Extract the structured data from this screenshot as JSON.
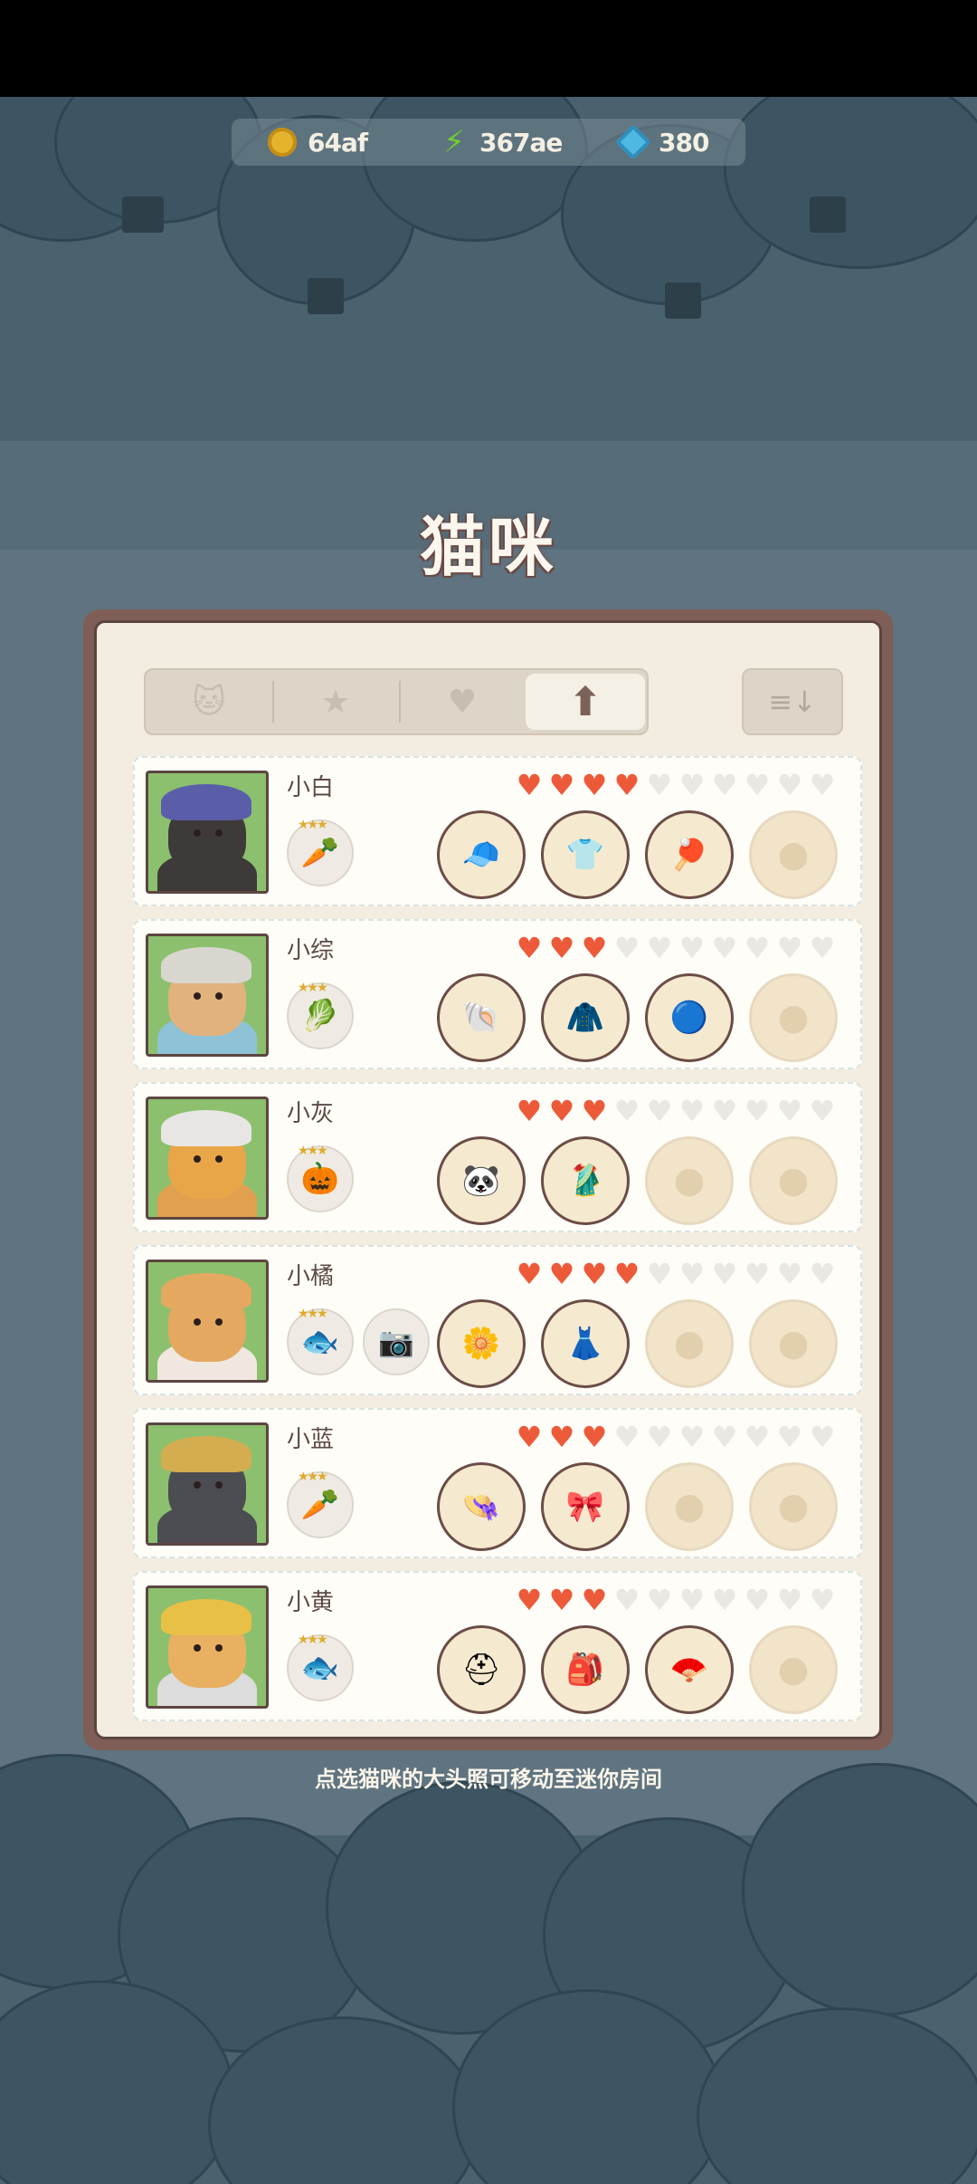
{
  "resources": [
    {
      "icon": "coin-icon",
      "value": "64af"
    },
    {
      "icon": "energy-bolt-icon",
      "value": "367ae"
    },
    {
      "icon": "gem-icon",
      "value": "380"
    }
  ],
  "title": "猫咪",
  "tabs": [
    {
      "icon": "cat-icon",
      "glyph": "🐱"
    },
    {
      "icon": "star-icon",
      "glyph": "★"
    },
    {
      "icon": "heart-icon",
      "glyph": "♥"
    },
    {
      "icon": "up-arrow-icon",
      "glyph": "⬆"
    }
  ],
  "sort_glyph": "≡↓",
  "cats": [
    {
      "name": "小白",
      "hearts": 4,
      "food": "🥕",
      "extra": "",
      "slots": [
        "🧢",
        "👕",
        "🏓",
        ""
      ],
      "head": "#3e3a3a",
      "hat": "#5a5ea8",
      "body": "#3e3a3a"
    },
    {
      "name": "小综",
      "hearts": 3,
      "food": "🥬",
      "extra": "",
      "slots": [
        "🐚",
        "🧥",
        "🔵",
        ""
      ],
      "head": "#e2b27e",
      "hat": "#d9d6d0",
      "body": "#8ec2d6"
    },
    {
      "name": "小灰",
      "hearts": 3,
      "food": "🎃",
      "extra": "",
      "slots": [
        "🐼",
        "🥻",
        "",
        ""
      ],
      "head": "#e9a648",
      "hat": "#e8e6e4",
      "body": "#e0a050"
    },
    {
      "name": "小橘",
      "hearts": 4,
      "food": "🐟",
      "extra": "📷",
      "slots": [
        "🌼",
        "👗",
        "",
        ""
      ],
      "head": "#e4a860",
      "hat": "#e4a860",
      "body": "#f0e8e0"
    },
    {
      "name": "小蓝",
      "hearts": 3,
      "food": "🥕",
      "extra": "",
      "slots": [
        "👒",
        "🎀",
        "",
        ""
      ],
      "head": "#4b4d52",
      "hat": "#d4ad50",
      "body": "#4b4d52"
    },
    {
      "name": "小黄",
      "hearts": 3,
      "food": "🐟",
      "extra": "",
      "slots": [
        "⛑",
        "🎒",
        "🪭",
        ""
      ],
      "head": "#e8b060",
      "hat": "#e8c046",
      "body": "#dcdcdc"
    }
  ],
  "max_hearts": 10,
  "empty_slot_glyph": "⬤",
  "hint": "点选猫咪的大头照可移动至迷你房间",
  "colors": {
    "heart_on": "#ec5a3a",
    "panel_border": "#7e5e56"
  }
}
